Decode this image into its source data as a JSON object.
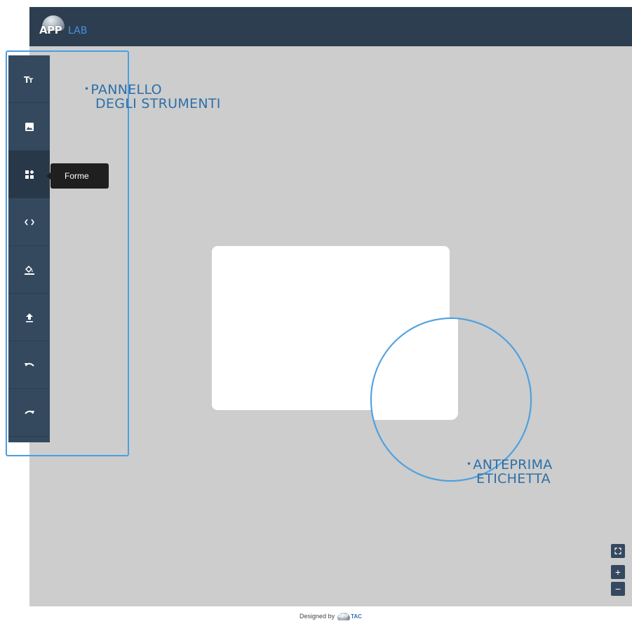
{
  "header": {
    "logo_app": "APP",
    "logo_lab": "LAB"
  },
  "toolbar": {
    "items": [
      {
        "name": "text-tool",
        "icon": "text-size-icon"
      },
      {
        "name": "image-tool",
        "icon": "image-icon"
      },
      {
        "name": "shapes-tool",
        "icon": "shapes-icon",
        "active": true
      },
      {
        "name": "code-tool",
        "icon": "code-icon"
      },
      {
        "name": "fill-tool",
        "icon": "paint-bucket-icon"
      },
      {
        "name": "upload-tool",
        "icon": "upload-icon"
      },
      {
        "name": "undo-tool",
        "icon": "undo-icon"
      },
      {
        "name": "redo-tool",
        "icon": "redo-icon"
      }
    ],
    "tooltip": "Forme"
  },
  "annotations": {
    "tools_line1": "PANNELLO",
    "tools_line2": "DEGLI STRUMENTI",
    "preview_line1": "ANTEPRIMA",
    "preview_line2": "ETICHETTA",
    "bullet": "•"
  },
  "zoom": {
    "fit": "⛶",
    "plus": "+",
    "minus": "−"
  },
  "footer": {
    "designed_by": "Designed by",
    "logo_app": "APP",
    "logo_tac": "TAC"
  },
  "colors": {
    "topbar": "#2c3e50",
    "toolbar": "#34495e",
    "canvas": "#cdcdcd",
    "accent": "#4a9fe0",
    "annotation": "#2e6fa8"
  }
}
